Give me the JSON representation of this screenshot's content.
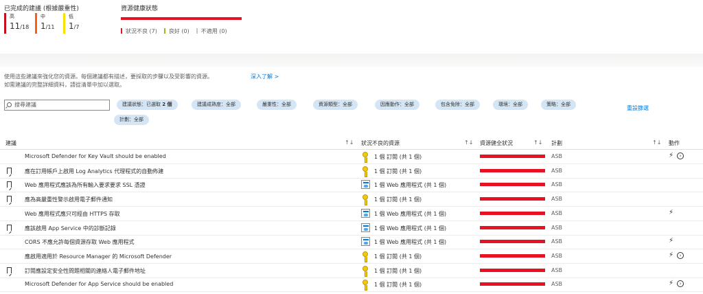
{
  "summary": {
    "completed_title": "已完成的建議 (根據嚴重性)",
    "high": {
      "label": "高",
      "done": "11",
      "total": "/18",
      "color": "#c50f1f"
    },
    "medium": {
      "label": "中",
      "done": "1",
      "total": "/11",
      "color": "#f7630c"
    },
    "low": {
      "label": "低",
      "done": "1",
      "total": "/7",
      "color": "#fce100"
    },
    "health_title": "資源健康狀態",
    "legend": [
      {
        "label": "狀況不良 (7)",
        "color": "#e81123"
      },
      {
        "label": "良好 (0)",
        "color": "#9bbb0f"
      },
      {
        "label": "不適用 (0)",
        "color": "#c8c6c4"
      }
    ]
  },
  "description": {
    "line1": "使用這些建議來強化您的資源。每個建議都有描述，要採取的步驟以及受影響的資源。",
    "line2": "如需建議的完整詳細資料，請從清單中加以選取。",
    "learn_more": "深入了解 >"
  },
  "filters": {
    "search_placeholder": "搜尋建議",
    "pills": [
      {
        "bold": false,
        "text": "建議狀態：已選取 ",
        "extra": "2 個"
      },
      {
        "text": "建議成熟度：全部"
      },
      {
        "text": "嚴重性：全部"
      },
      {
        "text": "資源類型：全部"
      },
      {
        "text": "因應動作：全部"
      },
      {
        "text": "包含免除：全部"
      },
      {
        "text": "環境：全部"
      },
      {
        "text": "策略：全部"
      },
      {
        "text": "計劃：全部"
      }
    ],
    "reset": "重設篩選"
  },
  "table": {
    "headers": {
      "recommendation": "建議",
      "unhealthy": "狀況不良的資源",
      "health": "資源健全狀況",
      "plan": "計劃",
      "actions": "動作",
      "sort_glyph": "↑↓"
    },
    "rows": [
      {
        "bookmark": false,
        "name": "Microsoft Defender for Key Vault should be enabled",
        "icon": "key-icon",
        "resources": "1 個 訂閱 (共 1 個)",
        "plan": "ASB",
        "bolt": true,
        "go": true
      },
      {
        "bookmark": true,
        "name": "應在訂用帳戶上啟用 Log Analytics 代理程式的自動佈建",
        "icon": "key-icon",
        "resources": "1 個 訂閱 (共 1 個)",
        "plan": "ASB",
        "bolt": false,
        "go": false
      },
      {
        "bookmark": true,
        "name": "Web 應用程式應該為所有輸入要求要求 SSL 憑證",
        "icon": "webapp-icon",
        "resources": "1 個 Web 應用程式 (共 1 個)",
        "plan": "ASB",
        "bolt": false,
        "go": false
      },
      {
        "bookmark": true,
        "name": "應為高嚴重性警示啟用電子郵件通知",
        "icon": "key-icon",
        "resources": "1 個 訂閱 (共 1 個)",
        "plan": "ASB",
        "bolt": false,
        "go": false
      },
      {
        "bookmark": false,
        "name": "Web 應用程式應只可經由 HTTPS 存取",
        "icon": "webapp-icon",
        "resources": "1 個 Web 應用程式 (共 1 個)",
        "plan": "ASB",
        "bolt": true,
        "go": false
      },
      {
        "bookmark": true,
        "name": "應該啟用 App Service 中的診斷記錄",
        "icon": "webapp-icon",
        "resources": "1 個 Web 應用程式 (共 1 個)",
        "plan": "ASB",
        "bolt": false,
        "go": false
      },
      {
        "bookmark": false,
        "name": "CORS 不應允許每個資源存取 Web 應用程式",
        "icon": "webapp-icon",
        "resources": "1 個 Web 應用程式 (共 1 個)",
        "plan": "ASB",
        "bolt": true,
        "go": false
      },
      {
        "bookmark": false,
        "name": "應啟用適用於 Resource Manager 的 Microsoft Defender",
        "icon": "key-icon",
        "resources": "1 個 訂閱 (共 1 個)",
        "plan": "ASB",
        "bolt": true,
        "go": true
      },
      {
        "bookmark": true,
        "name": "訂閱應設定安全性問題相關的連絡人電子郵件地址",
        "icon": "key-icon",
        "resources": "1 個 訂閱 (共 1 個)",
        "plan": "ASB",
        "bolt": false,
        "go": false
      },
      {
        "bookmark": false,
        "name": "Microsoft Defender for App Service should be enabled",
        "icon": "key-icon",
        "resources": "1 個 訂閱 (共 1 個)",
        "plan": "ASB",
        "bolt": true,
        "go": true
      }
    ],
    "bolt_glyph": "⚡",
    "go_glyph": "›"
  }
}
